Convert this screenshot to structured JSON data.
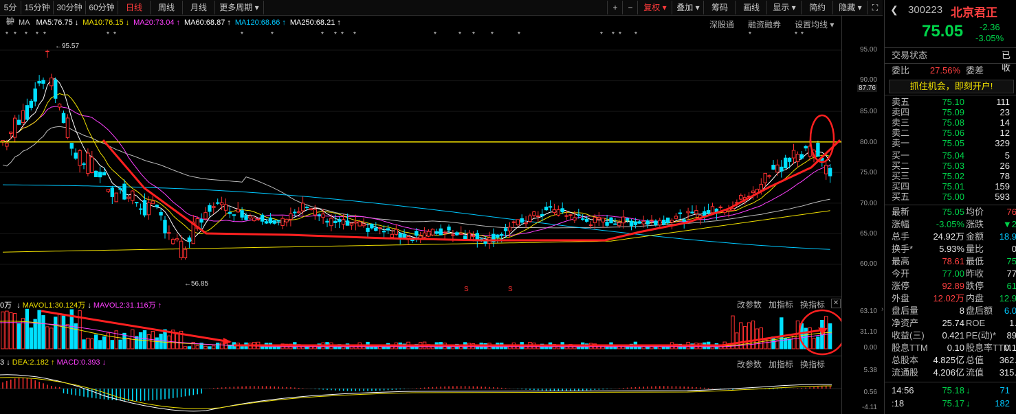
{
  "toolbar": {
    "periods": [
      "5分钟",
      "15分钟",
      "30分钟",
      "60分钟",
      "日线",
      "周线",
      "月线",
      "更多周期"
    ],
    "active": "日线",
    "right_buttons": [
      "+",
      "−",
      "复权",
      "叠加",
      "筹码",
      "画线",
      "显示",
      "简约",
      "隐藏"
    ]
  },
  "ma_legend": {
    "prefix": "MA",
    "items": [
      {
        "label": "MA5:76.75",
        "color": "#ffffff",
        "arrow": "↓"
      },
      {
        "label": "MA10:76.15",
        "color": "#f0e000",
        "arrow": "↓"
      },
      {
        "label": "MA20:73.04",
        "color": "#ff40ff",
        "arrow": "↑"
      },
      {
        "label": "MA60:68.87",
        "color": "#ffffff",
        "arrow": "↑"
      },
      {
        "label": "MA120:68.66",
        "color": "#00c8ff",
        "arrow": "↑"
      },
      {
        "label": "MA250:68.21",
        "color": "#ffffff",
        "arrow": "↑"
      }
    ],
    "links": [
      "深股通",
      "融资融券",
      "设置均线"
    ]
  },
  "price_axis": [
    "95.00",
    "90.00",
    "87.76",
    "85.00",
    "80.00",
    "75.00",
    "70.00",
    "65.00",
    "60.00"
  ],
  "annotations": {
    "high": "95.57",
    "low": "56.85"
  },
  "volume_panel": {
    "header": [
      "0万",
      "MAVOL1:30.124万",
      "MAVOL2:31.116万"
    ],
    "buttons": [
      "改参数",
      "加指标",
      "换指标"
    ],
    "axis": [
      "63.10",
      "31.10",
      "0.00"
    ]
  },
  "macd_panel": {
    "header": [
      "3",
      "DEA:2.182",
      "MACD:0.393"
    ],
    "buttons": [
      "改参数",
      "加指标",
      "换指标"
    ],
    "axis": [
      "5.38",
      "0.56",
      "-4.11"
    ]
  },
  "quote": {
    "code": "300223",
    "name": "北京君正",
    "price": "75.05",
    "change": "-2.36",
    "change_pct": "-3.05%",
    "status_label": "交易状态",
    "status_value": "已收",
    "webi_label": "委比",
    "webi_value": "27.56%",
    "weicha_label": "委差",
    "promo": "抓住机会，即刻开户!",
    "asks": [
      {
        "label": "卖五",
        "price": "75.10",
        "vol": "111"
      },
      {
        "label": "卖四",
        "price": "75.09",
        "vol": "23"
      },
      {
        "label": "卖三",
        "price": "75.08",
        "vol": "14"
      },
      {
        "label": "卖二",
        "price": "75.06",
        "vol": "12"
      },
      {
        "label": "卖一",
        "price": "75.05",
        "vol": "329"
      }
    ],
    "bids": [
      {
        "label": "买一",
        "price": "75.04",
        "vol": "5"
      },
      {
        "label": "买二",
        "price": "75.03",
        "vol": "26"
      },
      {
        "label": "买三",
        "price": "75.02",
        "vol": "78"
      },
      {
        "label": "买四",
        "price": "75.01",
        "vol": "159"
      },
      {
        "label": "买五",
        "price": "75.00",
        "vol": "593"
      }
    ],
    "stats": [
      {
        "l1": "最新",
        "v1": "75.05",
        "c1": "grn",
        "l2": "均价",
        "v2": "76",
        "c2": "red"
      },
      {
        "l1": "涨幅",
        "v1": "-3.05%",
        "c1": "grn",
        "l2": "涨跌",
        "v2": "▼2",
        "c2": "grn"
      },
      {
        "l1": "总手",
        "v1": "24.92万",
        "c1": "wht",
        "l2": "金额",
        "v2": "18.9",
        "c2": "cy"
      },
      {
        "l1": "换手*",
        "v1": "5.93%",
        "c1": "wht",
        "l2": "量比",
        "v2": "0",
        "c2": "wht"
      },
      {
        "l1": "最高",
        "v1": "78.61",
        "c1": "red",
        "l2": "最低",
        "v2": "75",
        "c2": "grn"
      },
      {
        "l1": "今开",
        "v1": "77.00",
        "c1": "grn",
        "l2": "昨收",
        "v2": "77",
        "c2": "wht"
      },
      {
        "l1": "涨停",
        "v1": "92.89",
        "c1": "red",
        "l2": "跌停",
        "v2": "61",
        "c2": "grn"
      },
      {
        "l1": "外盘",
        "v1": "12.02万",
        "c1": "red",
        "l2": "内盘",
        "v2": "12.9",
        "c2": "grn"
      },
      {
        "l1": "盘后量",
        "v1": "8",
        "c1": "wht",
        "l2": "盘后额",
        "v2": "6.0",
        "c2": "cy"
      },
      {
        "l1": "净资产",
        "v1": "25.74",
        "c1": "wht",
        "l2": "ROE",
        "v2": "1.",
        "c2": "wht"
      },
      {
        "l1": "收益(三)",
        "v1": "0.421",
        "c1": "wht",
        "l2": "PE(动)*",
        "v2": "89",
        "c2": "wht"
      },
      {
        "l1": "股息TTM",
        "v1": "0.10",
        "c1": "wht",
        "l2": "股息率TTM",
        "v2": "0.1",
        "c2": "wht"
      },
      {
        "l1": "总股本",
        "v1": "4.825亿",
        "c1": "wht",
        "l2": "总值",
        "v2": "362.",
        "c2": "wht"
      },
      {
        "l1": "流通股",
        "v1": "4.206亿",
        "c1": "wht",
        "l2": "流值",
        "v2": "315.",
        "c2": "wht"
      }
    ],
    "ticks": [
      {
        "time": "14:56",
        "price": "75.18",
        "vol": "71"
      },
      {
        "time": ":18",
        "price": "75.17",
        "vol": "182"
      }
    ]
  }
}
